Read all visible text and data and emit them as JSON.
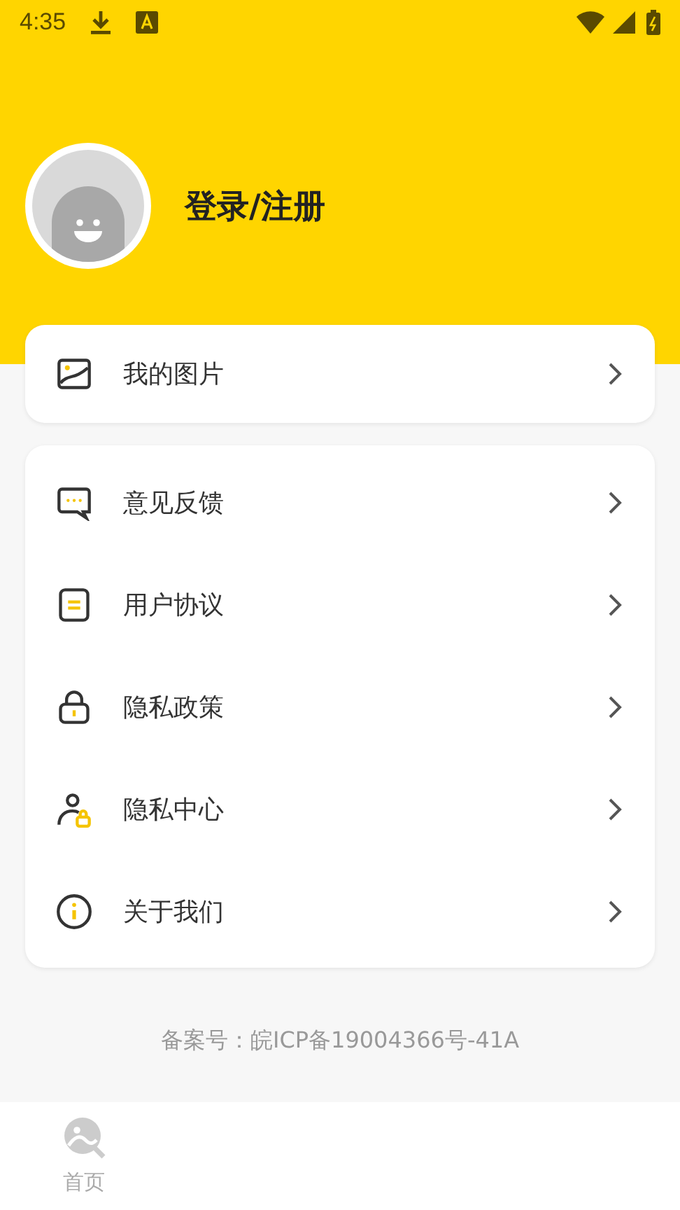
{
  "status_bar": {
    "time": "4:35"
  },
  "profile": {
    "login_label": "登录/注册"
  },
  "menu_groups": [
    {
      "items": [
        {
          "kind": "picture",
          "label": "我的图片"
        }
      ]
    },
    {
      "items": [
        {
          "kind": "chat",
          "label": "意见反馈"
        },
        {
          "kind": "document",
          "label": "用户协议"
        },
        {
          "kind": "lock",
          "label": "隐私政策"
        },
        {
          "kind": "user",
          "label": "隐私中心"
        },
        {
          "kind": "info",
          "label": "关于我们"
        }
      ]
    }
  ],
  "footer": {
    "icp": "备案号：皖ICP备19004366号-41A"
  },
  "bottom_nav": [
    {
      "label": "首页"
    }
  ]
}
